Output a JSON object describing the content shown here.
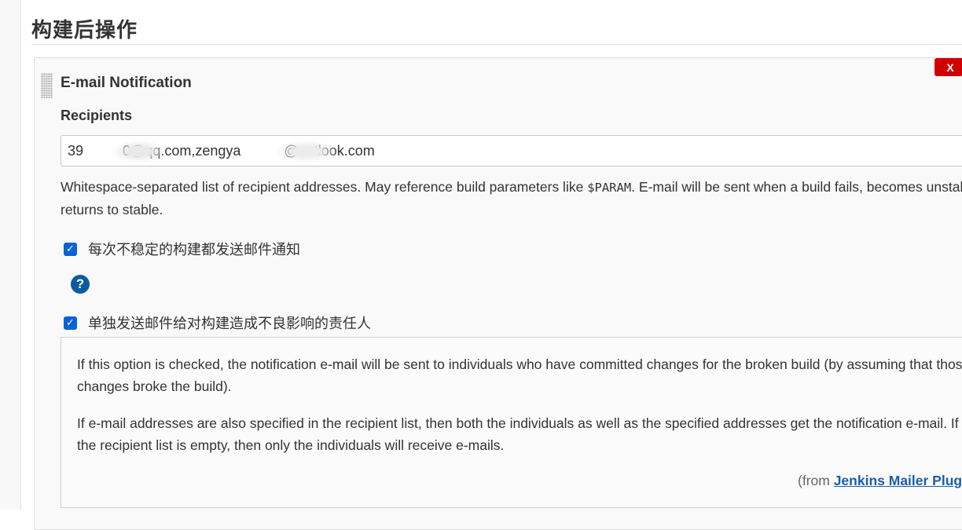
{
  "section": {
    "title": "构建后操作"
  },
  "publisher": {
    "title": "E-mail Notification",
    "delete_label": "X"
  },
  "recipients": {
    "label": "Recipients",
    "value": "39          0@qq.com,zengya           @outlook.com",
    "help_before": "Whitespace-separated list of recipient addresses. May reference build parameters like ",
    "help_code": "$PARAM",
    "help_after": ". E-mail will be sent when a build fails, becomes unstable or returns to stable."
  },
  "options": [
    {
      "label": "每次不稳定的构建都发送邮件通知",
      "checked": true
    },
    {
      "label": "单独发送邮件给对构建造成不良影响的责任人",
      "checked": true
    }
  ],
  "help_icon": {
    "glyph": "?"
  },
  "help_box": {
    "para1": "If this option is checked, the notification e-mail will be sent to individuals who have committed changes for the broken build (by assuming that those changes broke the build).",
    "para2": "If e-mail addresses are also specified in the recipient list, then both the individuals as well as the specified addresses get the notification e-mail. If the recipient list is empty, then only the individuals will receive e-mails.",
    "from_prefix": "(from ",
    "from_link": "Jenkins Mailer Plugin",
    "from_suffix": ")"
  },
  "colors": {
    "checkbox": "#0b62d6",
    "delete": "#d10000",
    "link": "#1e5ea8",
    "help_icon": "#0b5c9e"
  }
}
